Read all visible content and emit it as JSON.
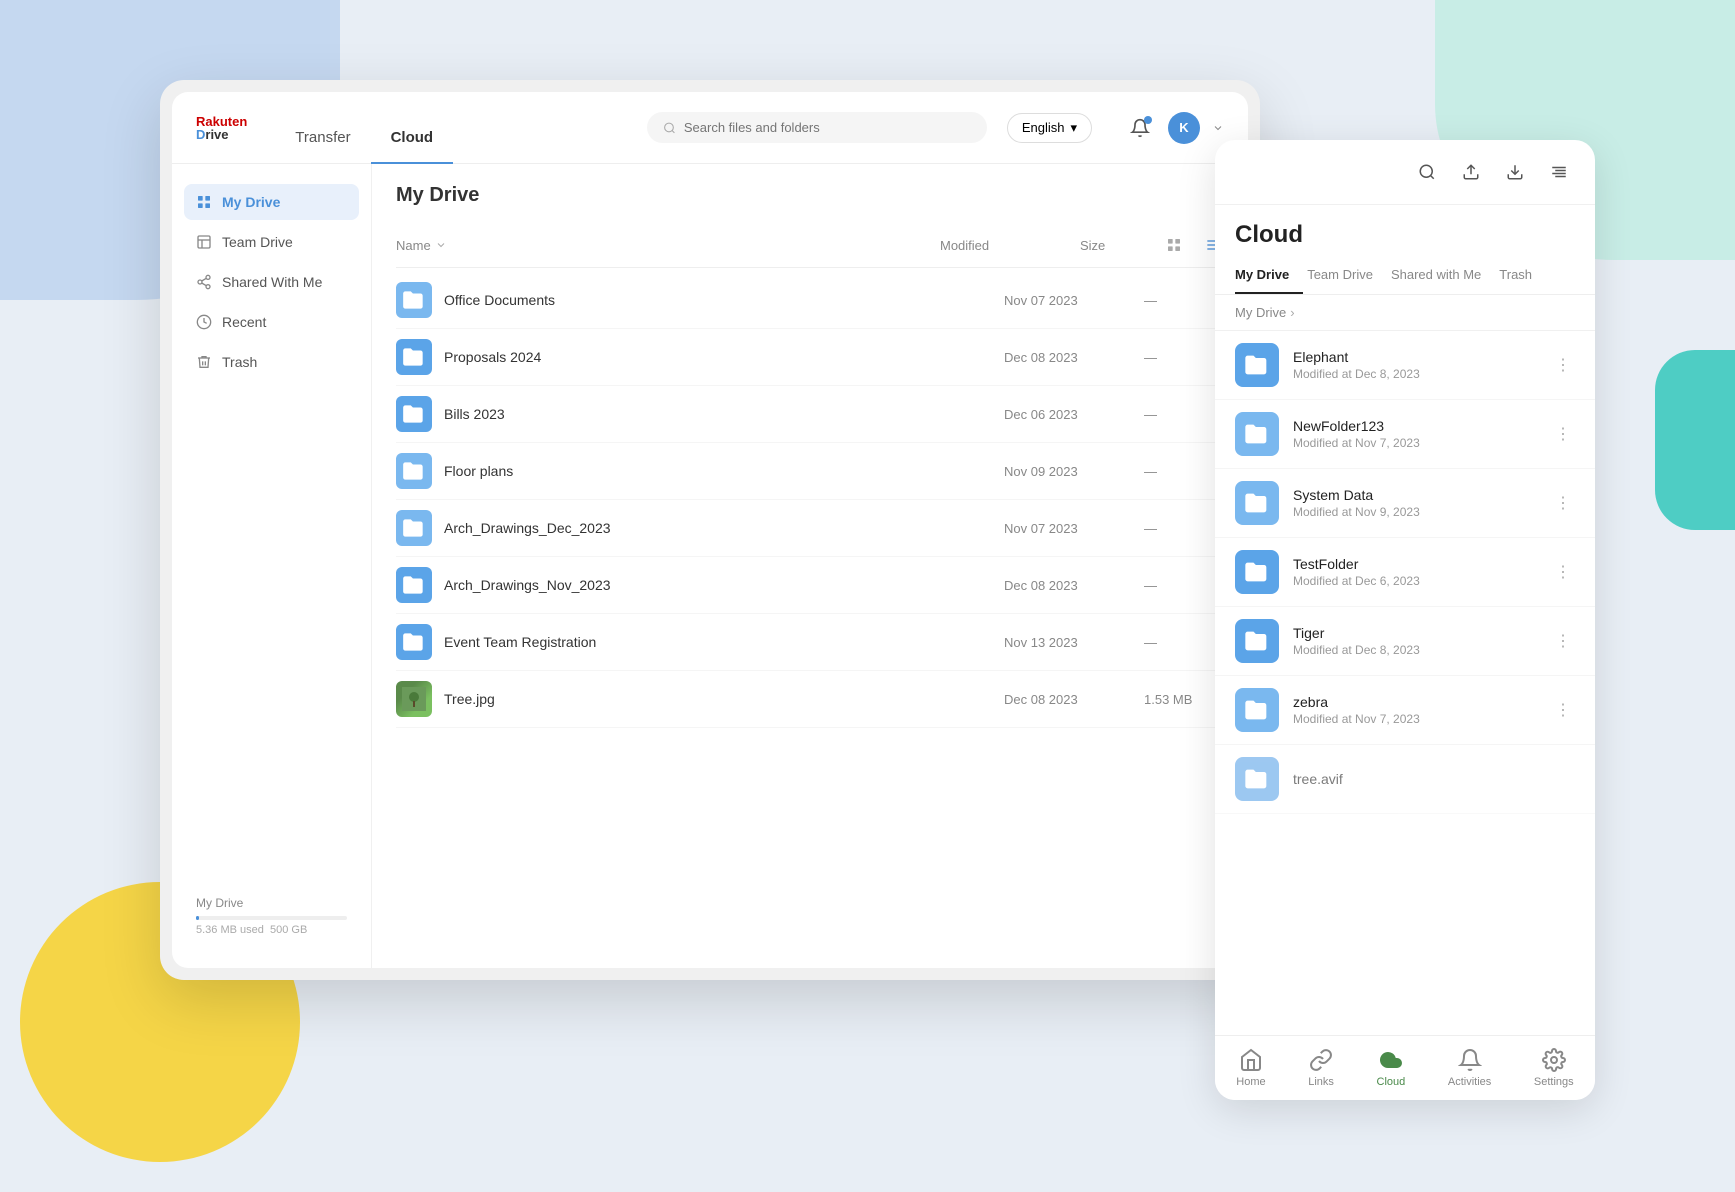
{
  "app": {
    "title": "Rakuten Drive"
  },
  "navbar": {
    "logo_top": "Rakuten",
    "logo_bottom": "Drive",
    "tabs": [
      {
        "id": "transfer",
        "label": "Transfer",
        "active": false
      },
      {
        "id": "cloud",
        "label": "Cloud",
        "active": true
      }
    ],
    "search_placeholder": "Search files and folders",
    "language": "English",
    "language_arrow": "▾",
    "user_initial": "K"
  },
  "sidebar": {
    "items": [
      {
        "id": "my-drive",
        "label": "My Drive",
        "active": true,
        "icon": "grid-icon"
      },
      {
        "id": "team-drive",
        "label": "Team Drive",
        "active": false,
        "icon": "team-icon"
      },
      {
        "id": "shared-with-me",
        "label": "Shared With Me",
        "active": false,
        "icon": "share-icon"
      },
      {
        "id": "recent",
        "label": "Recent",
        "active": false,
        "icon": "clock-icon"
      },
      {
        "id": "trash",
        "label": "Trash",
        "active": false,
        "icon": "trash-icon"
      }
    ],
    "storage": {
      "label": "My Drive",
      "used": "5.36 MB used",
      "total": "500 GB"
    }
  },
  "file_area": {
    "title": "My Drive",
    "columns": {
      "name": "Name",
      "modified": "Modified",
      "size": "Size"
    },
    "files": [
      {
        "name": "Office Documents",
        "type": "folder-shared",
        "modified": "Nov 07 2023",
        "size": "—"
      },
      {
        "name": "Proposals 2024",
        "type": "folder",
        "modified": "Dec 08 2023",
        "size": "—"
      },
      {
        "name": "Bills 2023",
        "type": "folder",
        "modified": "Dec 06 2023",
        "size": "—"
      },
      {
        "name": "Floor plans",
        "type": "folder-shared",
        "modified": "Nov 09 2023",
        "size": "—"
      },
      {
        "name": "Arch_Drawings_Dec_2023",
        "type": "folder-shared",
        "modified": "Nov 07 2023",
        "size": "—"
      },
      {
        "name": "Arch_Drawings_Nov_2023",
        "type": "folder",
        "modified": "Dec 08 2023",
        "size": "—"
      },
      {
        "name": "Event Team Registration",
        "type": "folder",
        "modified": "Nov 13 2023",
        "size": "—"
      },
      {
        "name": "Tree.jpg",
        "type": "image",
        "modified": "Dec 08 2023",
        "size": "1.53 MB"
      }
    ]
  },
  "right_panel": {
    "title": "Cloud",
    "tabs": [
      {
        "id": "my-drive",
        "label": "My Drive",
        "active": true
      },
      {
        "id": "team-drive",
        "label": "Team Drive",
        "active": false
      },
      {
        "id": "shared-with-me",
        "label": "Shared with Me",
        "active": false
      },
      {
        "id": "trash",
        "label": "Trash",
        "active": false
      }
    ],
    "breadcrumb": {
      "root": "My Drive",
      "separator": "›"
    },
    "files": [
      {
        "name": "Elephant",
        "type": "folder",
        "modified": "Modified at Dec 8, 2023"
      },
      {
        "name": "NewFolder123",
        "type": "folder-shared",
        "modified": "Modified at Nov 7, 2023"
      },
      {
        "name": "System Data",
        "type": "folder-shared",
        "modified": "Modified at Nov 9, 2023"
      },
      {
        "name": "TestFolder",
        "type": "folder",
        "modified": "Modified at Dec 6, 2023"
      },
      {
        "name": "Tiger",
        "type": "folder",
        "modified": "Modified at Dec 8, 2023"
      },
      {
        "name": "zebra",
        "type": "folder-shared",
        "modified": "Modified at Nov 7, 2023"
      },
      {
        "name": "tree.avif",
        "type": "file",
        "modified": ""
      }
    ],
    "bottom_nav": [
      {
        "id": "home",
        "label": "Home",
        "icon": "home-icon",
        "active": false
      },
      {
        "id": "links",
        "label": "Links",
        "icon": "link-icon",
        "active": false
      },
      {
        "id": "cloud",
        "label": "Cloud",
        "icon": "cloud-icon",
        "active": true
      },
      {
        "id": "activities",
        "label": "Activities",
        "icon": "bell-icon",
        "active": false
      },
      {
        "id": "settings",
        "label": "Settings",
        "icon": "settings-icon",
        "active": false
      }
    ]
  },
  "colors": {
    "accent_blue": "#4a90d9",
    "folder_blue": "#5ba4e8",
    "folder_light": "#7ab8ef",
    "active_green": "#4a8a4a",
    "red": "#cc0000"
  }
}
